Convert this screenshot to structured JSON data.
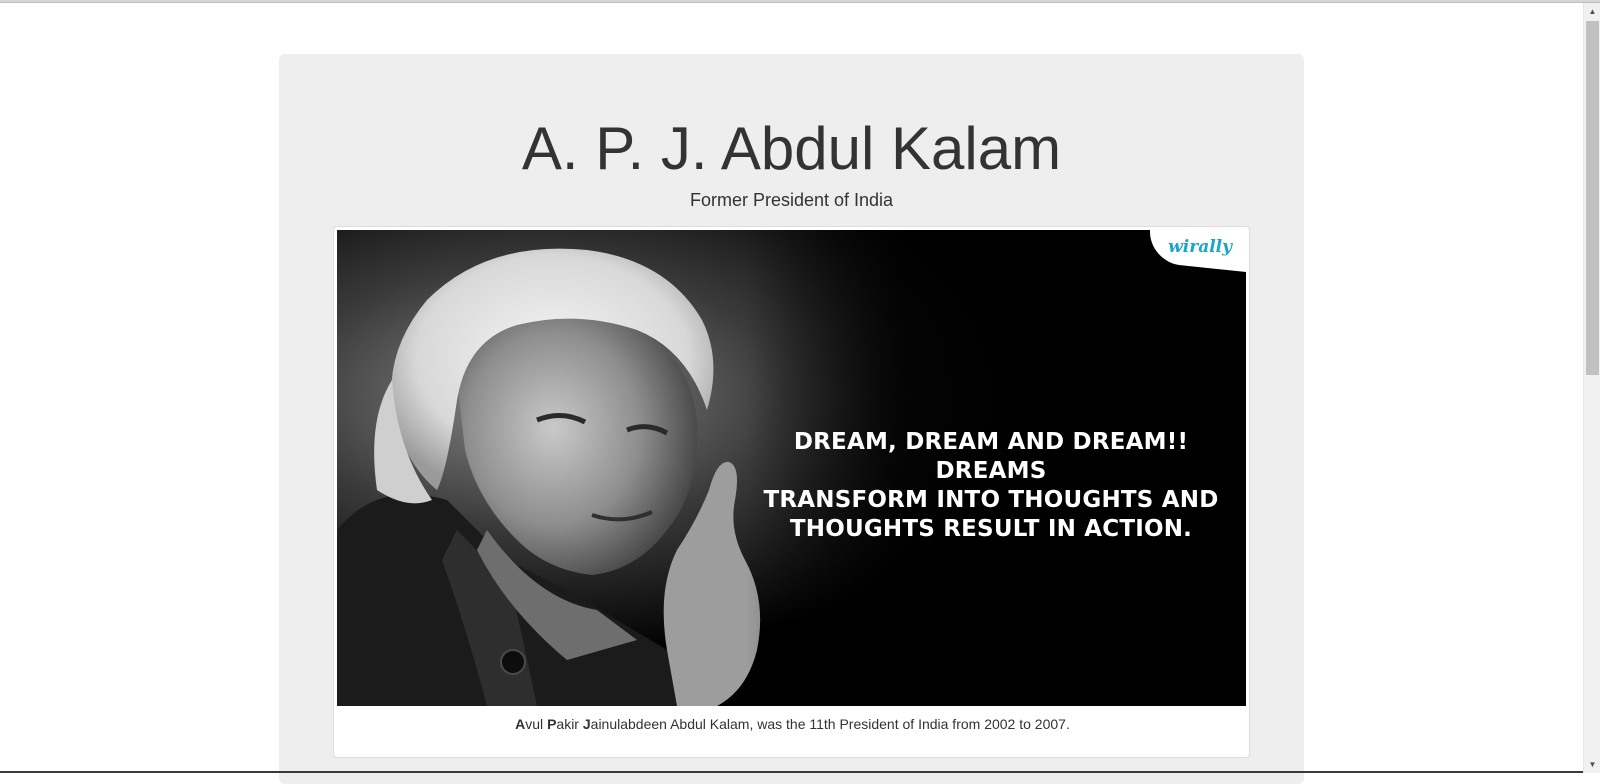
{
  "header": {
    "title": "A. P. J. Abdul Kalam",
    "subtitle": "Former President of India"
  },
  "image": {
    "quote_line1": "DREAM, DREAM AND DREAM!! DREAMS",
    "quote_line2": "TRANSFORM INTO THOUGHTS AND",
    "quote_line3": "THOUGHTS RESULT IN ACTION.",
    "logo_text": "wirally"
  },
  "caption": {
    "a": "A",
    "a_rest": "vul ",
    "p": "P",
    "p_rest": "akir ",
    "j": "J",
    "j_rest": "ainulabdeen Abdul Kalam, was the 11th President of India from 2002 to 2007."
  },
  "colors": {
    "page_bg": "#ffffff",
    "jumbotron_bg": "#eeeeee",
    "text": "#333333",
    "logo": "#1aa6c9"
  },
  "scrollbar": {
    "up_icon": "triangle-up",
    "down_icon": "triangle-down"
  }
}
